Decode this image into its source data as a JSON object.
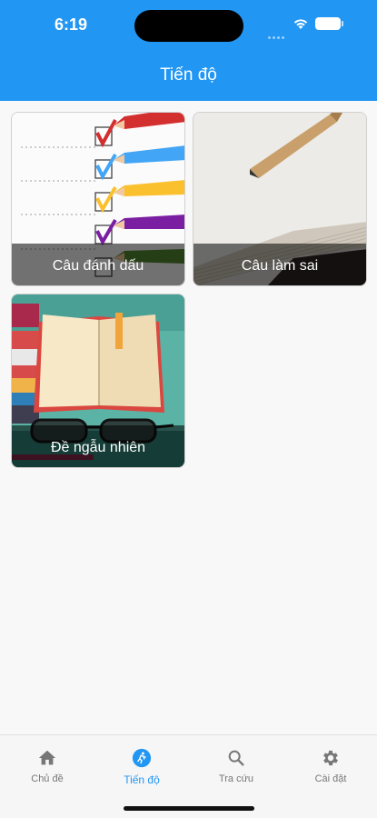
{
  "status_bar": {
    "time": "6:19"
  },
  "header": {
    "title": "Tiến độ"
  },
  "cards": [
    {
      "label": "Câu đánh dấu",
      "image": "checklist-pencils-image"
    },
    {
      "label": "Câu làm sai",
      "image": "notebook-pencil-image"
    },
    {
      "label": "Đề ngẫu nhiên",
      "image": "open-book-glasses-image"
    }
  ],
  "bottom_nav": {
    "items": [
      {
        "label": "Chủ đề",
        "icon": "home-icon"
      },
      {
        "label": "Tiến độ",
        "icon": "running-icon",
        "active": true
      },
      {
        "label": "Tra cứu",
        "icon": "search-icon"
      },
      {
        "label": "Cài đặt",
        "icon": "gear-icon"
      }
    ]
  },
  "colors": {
    "primary": "#2196f3",
    "inactive": "#777777"
  }
}
